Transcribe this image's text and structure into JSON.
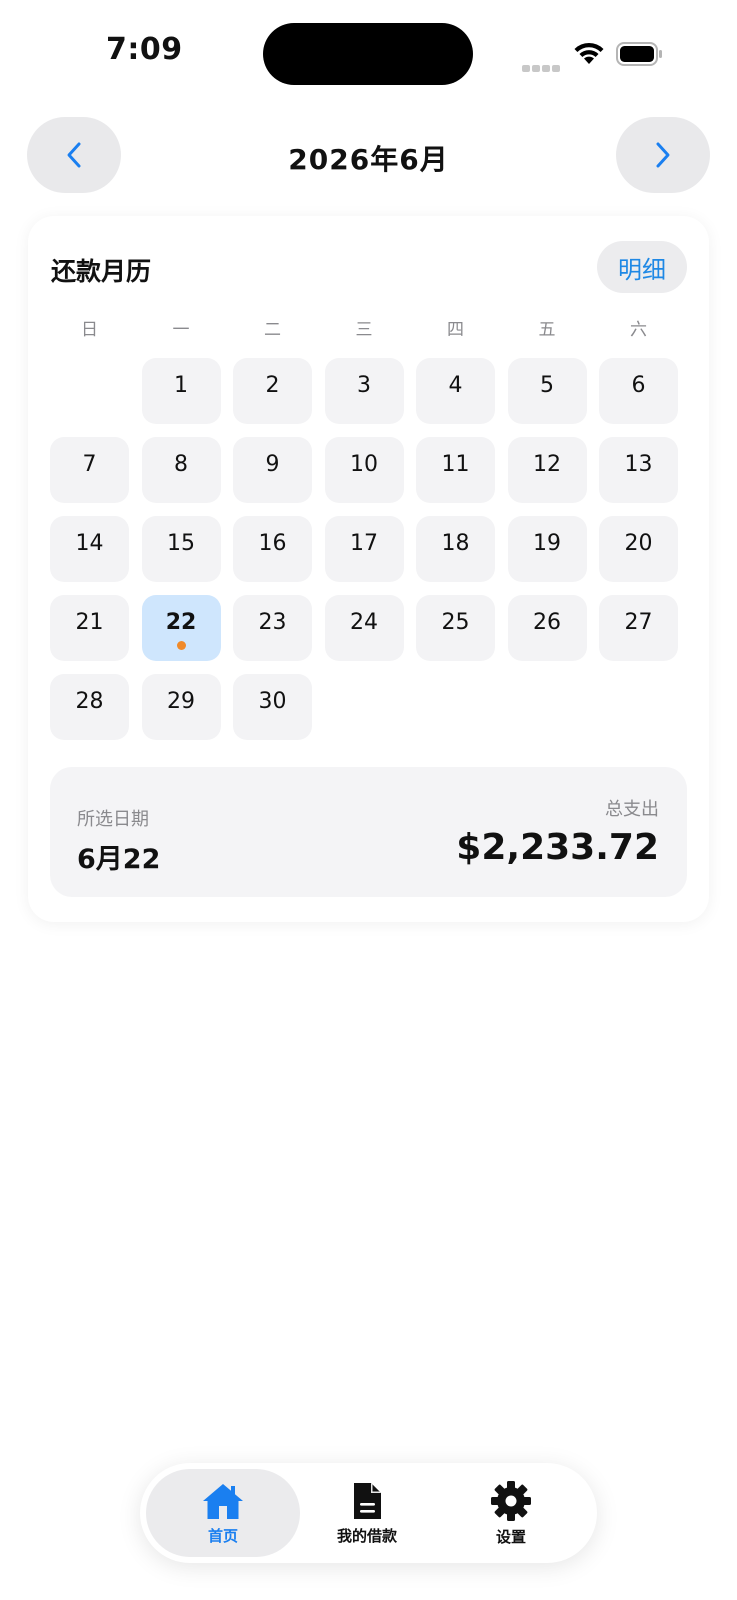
{
  "status_bar": {
    "time": "7:09"
  },
  "calendar_nav": {
    "month_title": "2026年6月"
  },
  "card": {
    "title": "还款月历",
    "detail_button": "明细",
    "weekdays": [
      "日",
      "一",
      "二",
      "三",
      "四",
      "五",
      "六"
    ],
    "days": [
      "1",
      "2",
      "3",
      "4",
      "5",
      "6",
      "7",
      "8",
      "9",
      "10",
      "11",
      "12",
      "13",
      "14",
      "15",
      "16",
      "17",
      "18",
      "19",
      "20",
      "21",
      "22",
      "23",
      "24",
      "25",
      "26",
      "27",
      "28",
      "29",
      "30"
    ],
    "first_weekday_index": 1,
    "selected_day": "22",
    "marked_days": [
      "22"
    ]
  },
  "summary": {
    "selected_date_label": "所选日期",
    "selected_date_value": "6月22",
    "total_label": "总支出",
    "total_value": "$2,233.72"
  },
  "tab_bar": {
    "tabs": [
      {
        "id": "home",
        "label": "首页",
        "icon": "house-icon",
        "active": true
      },
      {
        "id": "loans",
        "label": "我的借款",
        "icon": "document-icon",
        "active": false
      },
      {
        "id": "settings",
        "label": "设置",
        "icon": "gear-icon",
        "active": false
      }
    ]
  },
  "colors": {
    "accent": "#1a7ff0",
    "selected_day_bg": "#cfe6fd",
    "marker_dot": "#f08a2a",
    "cell_bg": "#f3f3f5"
  }
}
